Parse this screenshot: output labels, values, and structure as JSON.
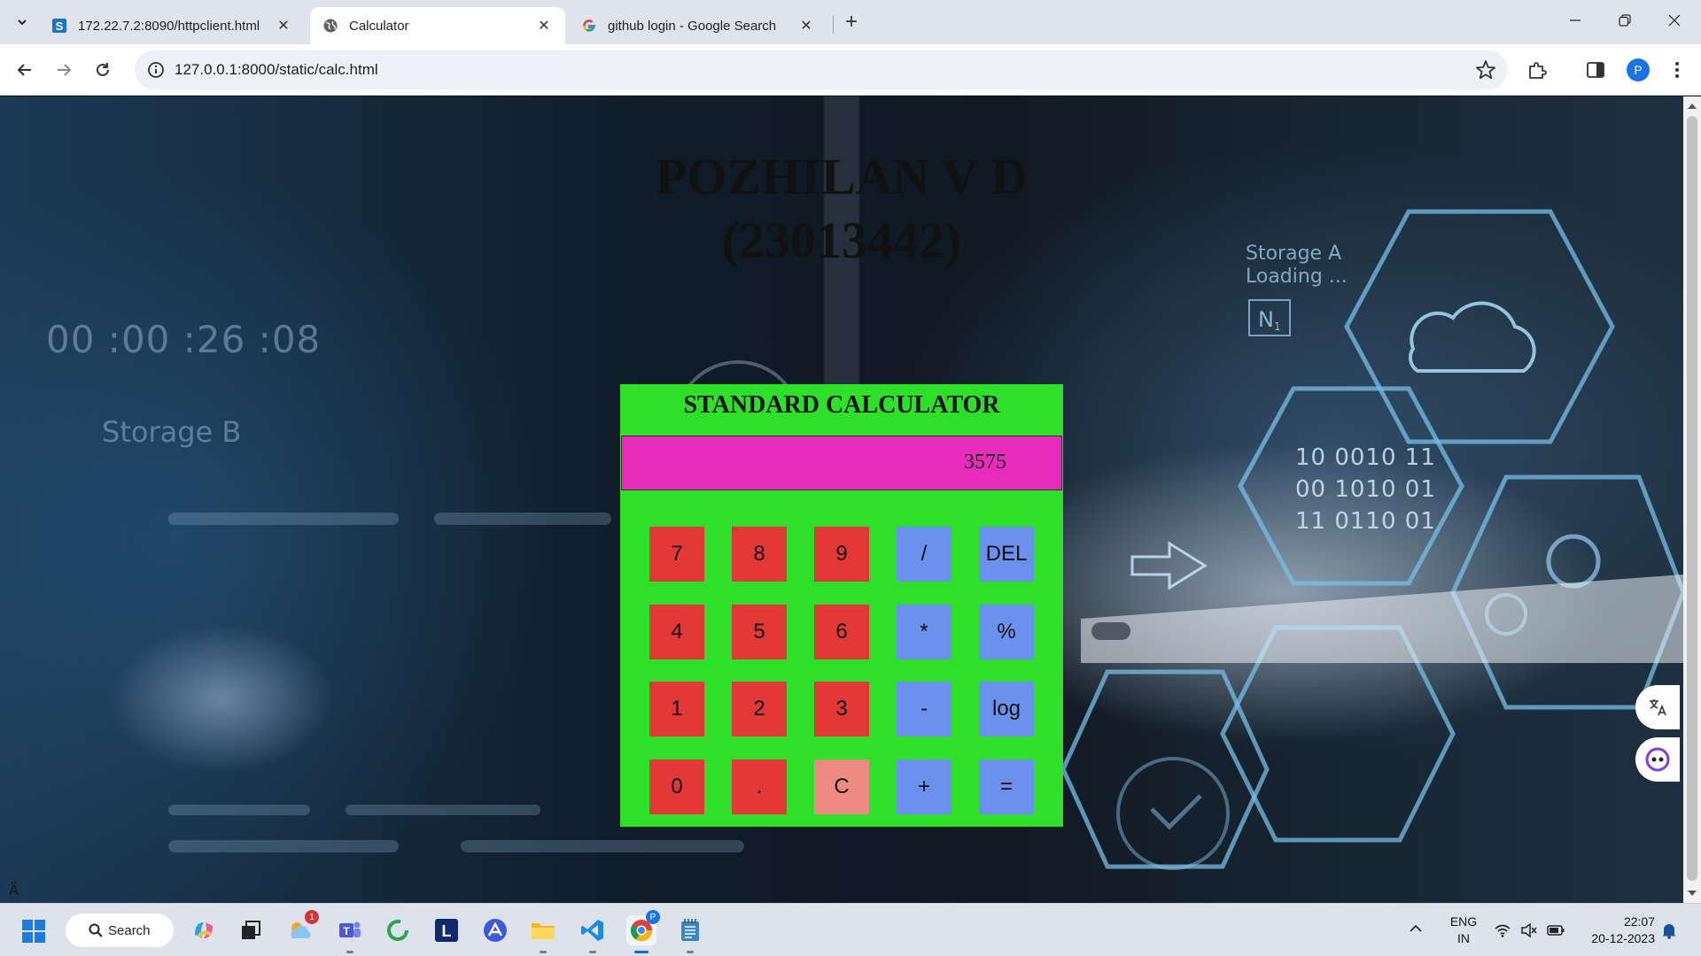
{
  "browser": {
    "tabs": [
      {
        "title": "172.22.7.2:8090/httpclient.html",
        "favicon": "s-badge-icon",
        "active": false
      },
      {
        "title": "Calculator",
        "favicon": "globe-icon",
        "active": true
      },
      {
        "title": "github login - Google Search",
        "favicon": "google-g-icon",
        "active": false
      }
    ],
    "url": "127.0.0.1:8000/static/calc.html",
    "profile_initial": "P"
  },
  "page": {
    "heading_line1": "POZHILAN V D",
    "heading_line2": "(23013442)",
    "calculator": {
      "title": "STANDARD CALCULATOR",
      "display_value": "3575",
      "keys": [
        [
          "7",
          "8",
          "9",
          "/",
          "DEL"
        ],
        [
          "4",
          "5",
          "6",
          "*",
          "%"
        ],
        [
          "1",
          "2",
          "3",
          "-",
          "log"
        ],
        [
          "0",
          ".",
          "C",
          "+",
          "="
        ]
      ],
      "colors": {
        "body": "#2fe02a",
        "display": "#e82bba",
        "number_key": "#e23838",
        "operator_key": "#6a91ee",
        "clear_key": "#ef8a82"
      }
    },
    "background_text": {
      "timer": "00 :00 :26 :08",
      "storage_b": "Storage B",
      "storage_a": "Storage A",
      "loading": "Loading ...",
      "node_label": "N1",
      "binary": [
        "10 0010 11",
        "00 1010 01",
        "11 0110 01"
      ]
    },
    "corner_glyph": "Ä"
  },
  "taskbar": {
    "search_label": "Search",
    "lang_line1": "ENG",
    "lang_line2": "IN",
    "time": "22:07",
    "date": "20-12-2023",
    "weather_badge": "1",
    "chrome_profile_badge": "P"
  }
}
